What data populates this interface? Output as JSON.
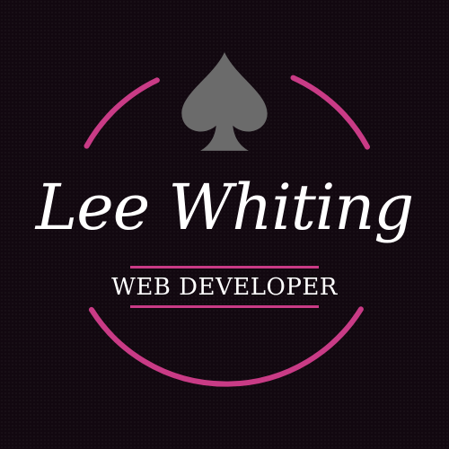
{
  "brand": {
    "name": "Lee Whiting",
    "role": "WEB DEVELOPER",
    "emblem_icon": "spade-icon"
  },
  "colors": {
    "background": "#120810",
    "accent": "#c93b86",
    "emblem": "#6b6b6b",
    "text": "#ffffff"
  }
}
